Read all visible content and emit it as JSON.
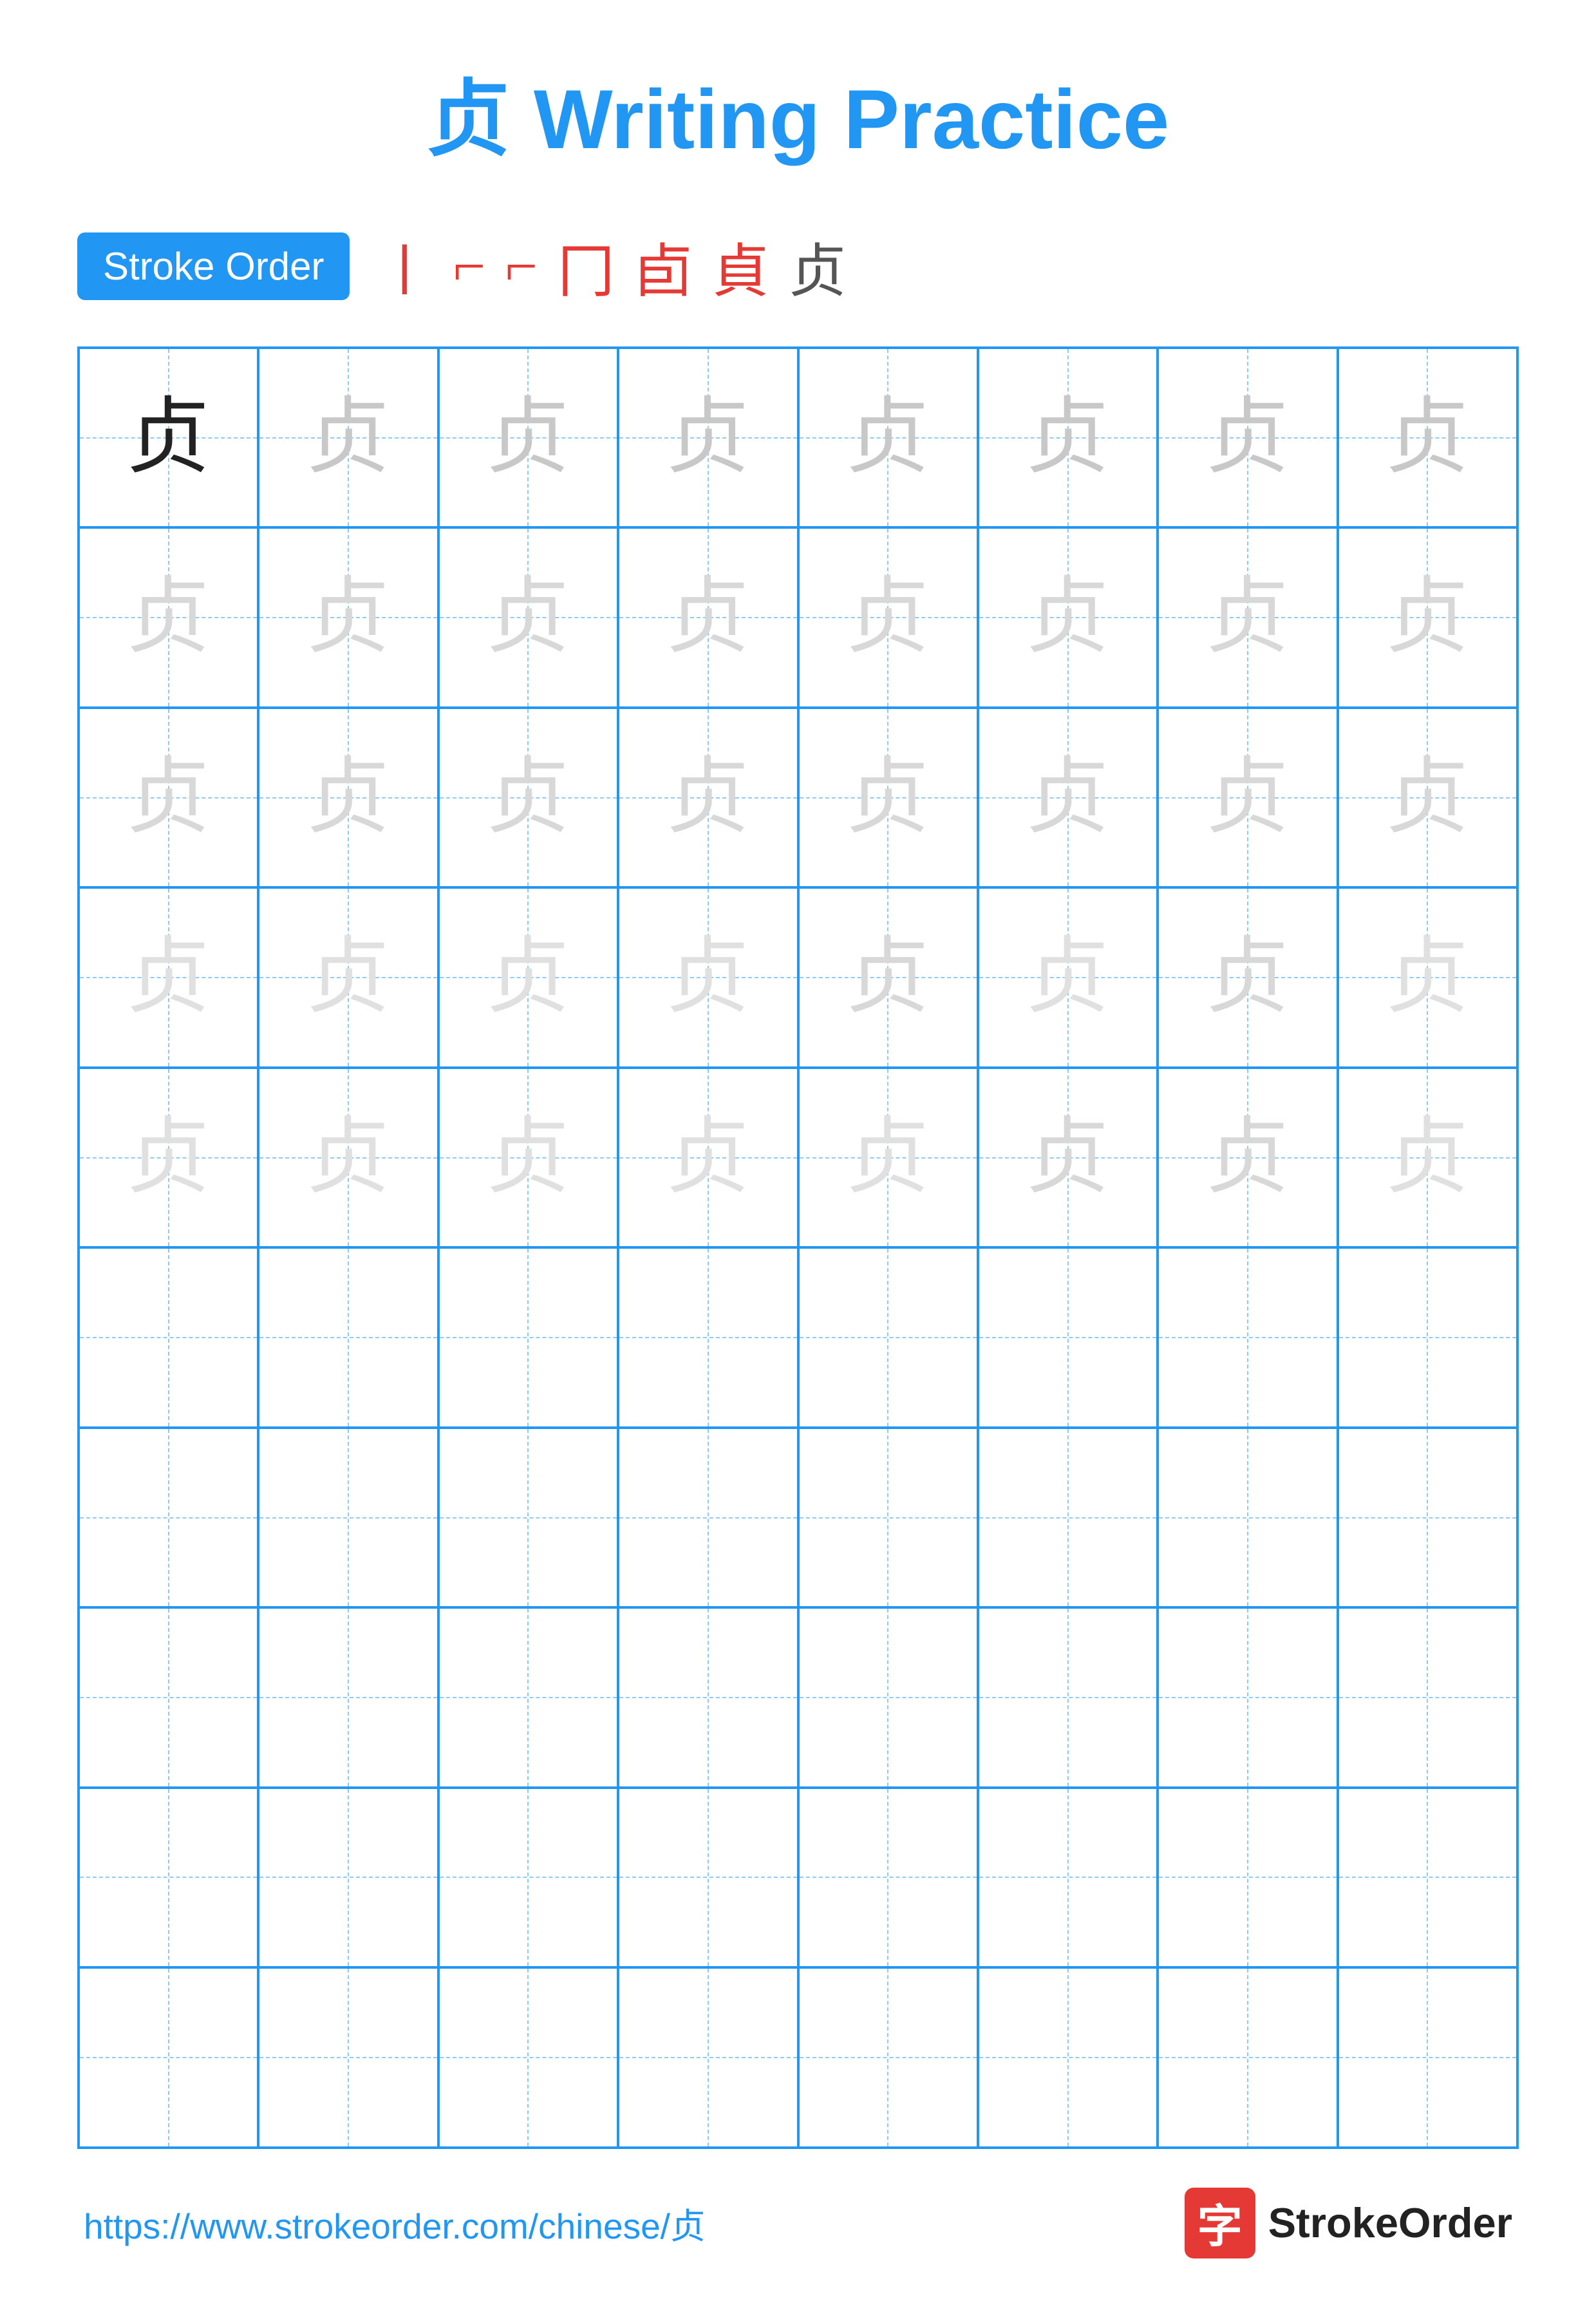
{
  "title": {
    "char": "贞",
    "text": "Writing Practice"
  },
  "stroke_order": {
    "badge_label": "Stroke Order",
    "strokes": [
      "'",
      "ㄱ",
      "⌐",
      "冖",
      "卣",
      "贞",
      "贞"
    ]
  },
  "grid": {
    "rows": 10,
    "cols": 8,
    "char": "贞"
  },
  "footer": {
    "url": "https://www.strokeorder.com/chinese/贞",
    "logo_text": "StrokeOrder",
    "logo_char": "字"
  }
}
